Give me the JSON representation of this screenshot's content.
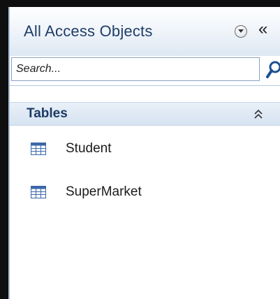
{
  "nav_pane": {
    "title": "All Access Objects",
    "dropdown_icon": "circle-chevron-down-icon",
    "collapse_label": "«",
    "search": {
      "placeholder": "Search...",
      "value": ""
    },
    "search_icon": "magnifier-icon",
    "groups": [
      {
        "title": "Tables",
        "collapse_icon": "double-chevron-up-icon",
        "items": [
          {
            "label": "Student",
            "icon": "table-icon"
          },
          {
            "label": "SuperMarket",
            "icon": "table-icon"
          }
        ]
      }
    ]
  },
  "colors": {
    "title_text": "#1f3e68",
    "section_text": "#1c3a63",
    "header_gradient_end": "#dde8f4",
    "search_border": "#8aa2c2",
    "search_icon": "#1d4f91",
    "table_icon_blue": "#3a67a8"
  }
}
